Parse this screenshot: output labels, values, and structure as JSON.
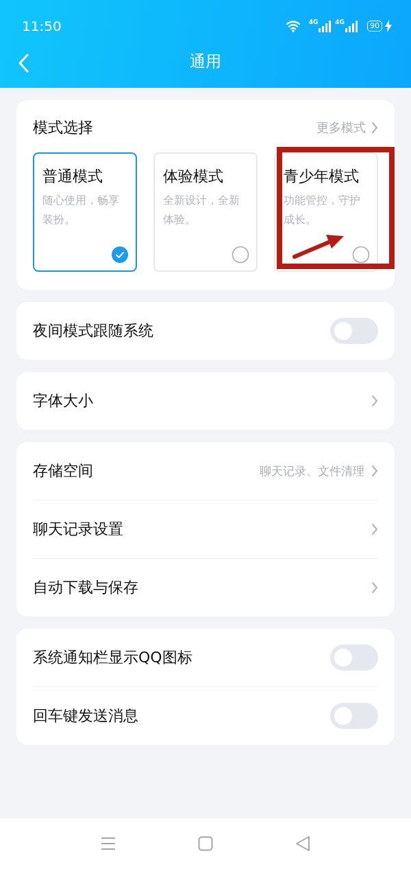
{
  "status_bar": {
    "time": "11:50",
    "network_1": "4G",
    "network_2": "4G",
    "battery": "90"
  },
  "nav": {
    "title": "通用"
  },
  "mode_section": {
    "title": "模式选择",
    "more": "更多模式",
    "modes": [
      {
        "name": "普通模式",
        "description": "随心使用，畅享装扮。",
        "selected": true
      },
      {
        "name": "体验模式",
        "description": "全新设计，全新体验。",
        "selected": false
      },
      {
        "name": "青少年模式",
        "description": "功能管控，守护成长。",
        "selected": false
      }
    ]
  },
  "groups": [
    {
      "rows": [
        {
          "kind": "toggle",
          "label": "夜间模式跟随系统",
          "on": false
        }
      ]
    },
    {
      "rows": [
        {
          "kind": "link",
          "label": "字体大小"
        }
      ]
    },
    {
      "rows": [
        {
          "kind": "link",
          "label": "存储空间",
          "value": "聊天记录、文件清理"
        },
        {
          "kind": "link",
          "label": "聊天记录设置"
        },
        {
          "kind": "link",
          "label": "自动下载与保存"
        }
      ]
    },
    {
      "rows": [
        {
          "kind": "toggle",
          "label": "系统通知栏显示QQ图标",
          "on": false
        },
        {
          "kind": "toggle",
          "label": "回车键发送消息",
          "on": false
        }
      ]
    }
  ]
}
